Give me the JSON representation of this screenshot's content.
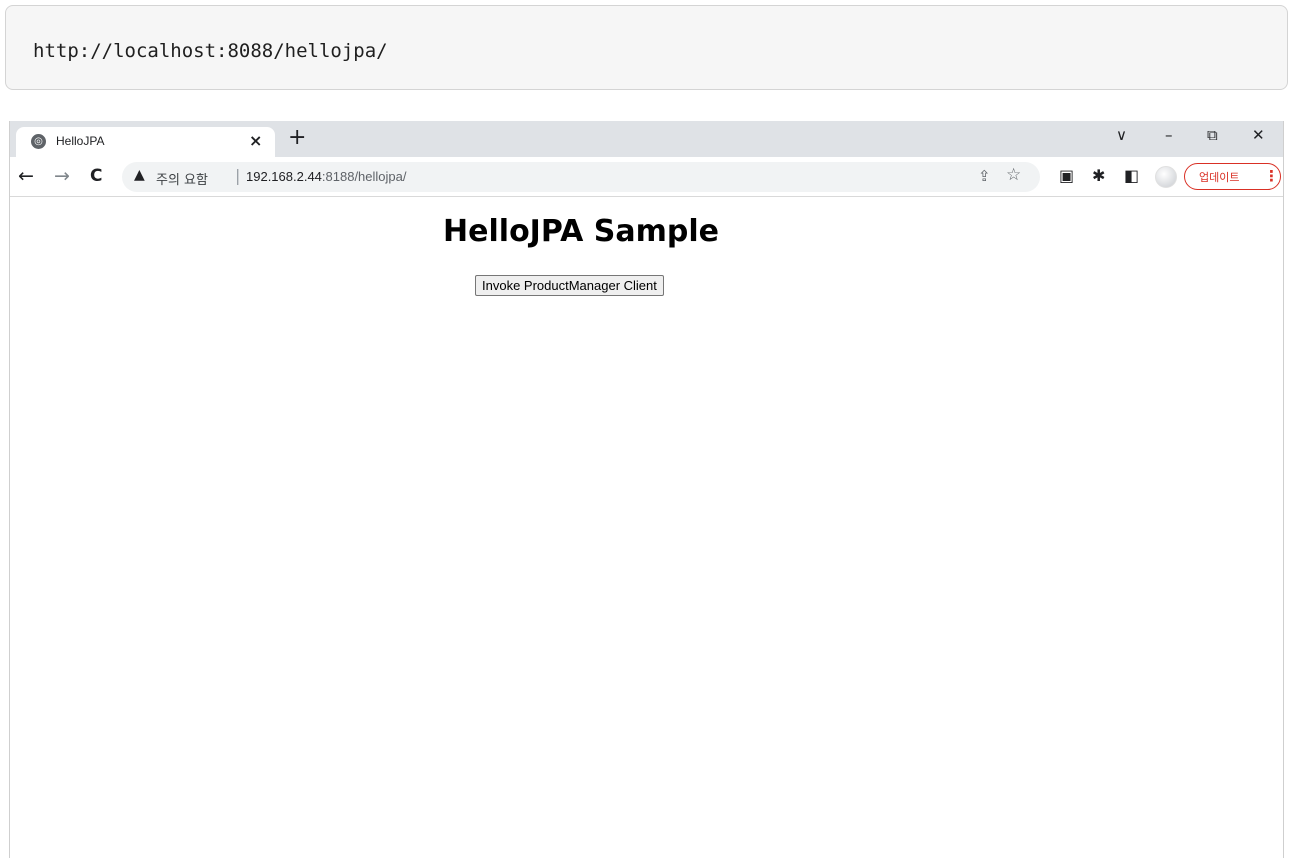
{
  "code_box": {
    "text": "http://localhost:8088/hellojpa/"
  },
  "browser": {
    "tab": {
      "title": "HelloJPA",
      "close": "×",
      "favicon": "globe-icon"
    },
    "new_tab": "+",
    "window_controls": {
      "tab_search": "∨",
      "minimize": "–",
      "restore": "⧉",
      "close": "✕"
    },
    "nav": {
      "back": "←",
      "forward": "→",
      "reload": "C"
    },
    "omnibox": {
      "warning_icon": "▲",
      "security_text": "주의 요함",
      "separator": "|",
      "host": "192.168.2.44",
      "path": ":8188/hellojpa/",
      "share_icon": "⇪",
      "star_icon": "☆"
    },
    "toolbar_icons": {
      "media": "▣",
      "extensions": "✱",
      "side_panel": "◧"
    },
    "update_button": {
      "label": "업데이트",
      "menu": "⋮"
    }
  },
  "page": {
    "heading": "HelloJPA Sample",
    "button_label": "Invoke ProductManager Client"
  }
}
